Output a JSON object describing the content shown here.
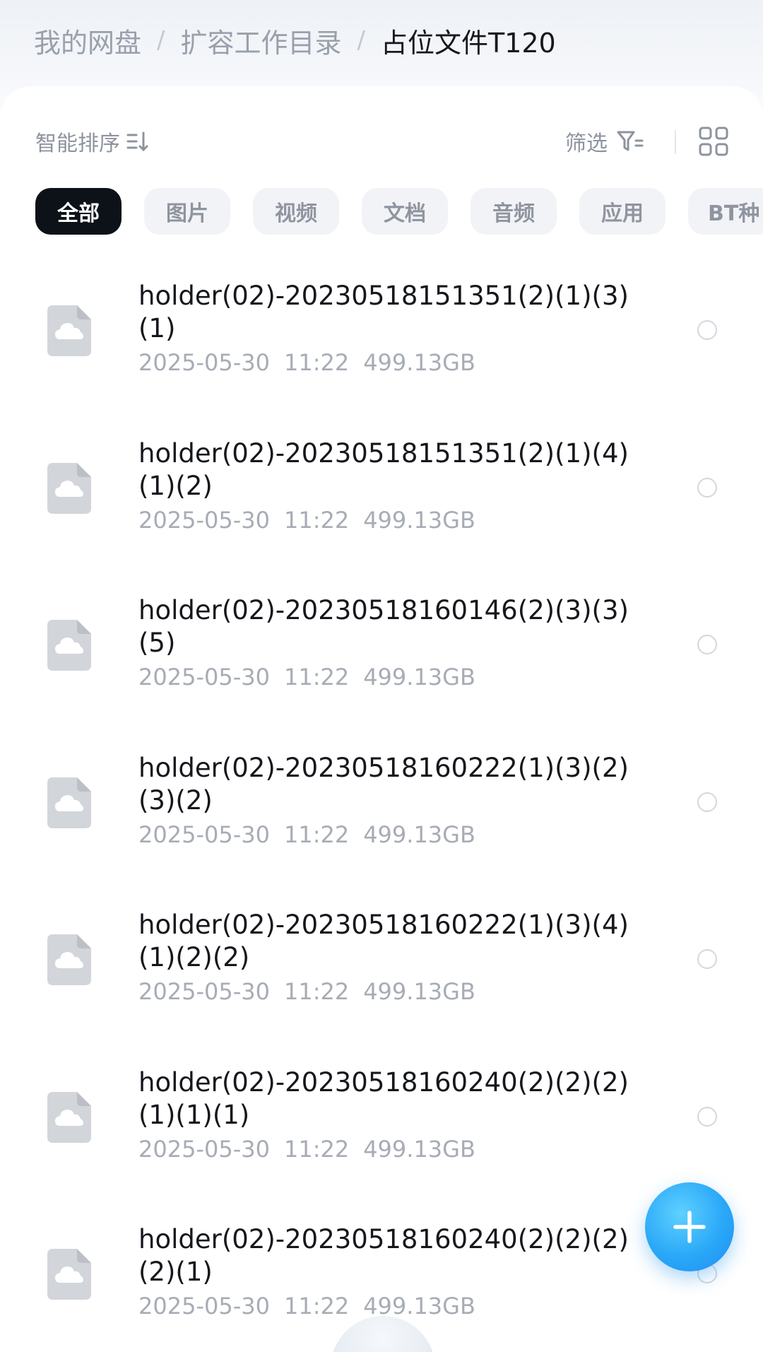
{
  "breadcrumb": {
    "items": [
      "我的网盘",
      "扩容工作目录",
      "占位文件T120"
    ],
    "separator": "/"
  },
  "toolbar": {
    "sort_label": "智能排序",
    "filter_label": "筛选"
  },
  "tabs": [
    "全部",
    "图片",
    "视频",
    "文档",
    "音频",
    "应用",
    "BT种"
  ],
  "active_tab": "全部",
  "files": [
    {
      "name": "holder(02)-20230518151351(2)(1)(3)(1)",
      "date": "2025-05-30",
      "time": "11:22",
      "size": "499.13GB"
    },
    {
      "name": "holder(02)-20230518151351(2)(1)(4)(1)(2)",
      "date": "2025-05-30",
      "time": "11:22",
      "size": "499.13GB"
    },
    {
      "name": "holder(02)-20230518160146(2)(3)(3)(5)",
      "date": "2025-05-30",
      "time": "11:22",
      "size": "499.13GB"
    },
    {
      "name": "holder(02)-20230518160222(1)(3)(2)(3)(2)",
      "date": "2025-05-30",
      "time": "11:22",
      "size": "499.13GB"
    },
    {
      "name": "holder(02)-20230518160222(1)(3)(4)(1)(2)(2)",
      "date": "2025-05-30",
      "time": "11:22",
      "size": "499.13GB"
    },
    {
      "name": "holder(02)-20230518160240(2)(2)(2)(1)(1)(1)",
      "date": "2025-05-30",
      "time": "11:22",
      "size": "499.13GB"
    },
    {
      "name": "holder(02)-20230518160240(2)(2)(2)(2)(1)",
      "date": "2025-05-30",
      "time": "11:22",
      "size": "499.13GB"
    }
  ],
  "icons": {
    "file": "cloud-file-icon",
    "sort": "sort-icon",
    "filter": "filter-icon",
    "grid": "grid-view-icon",
    "fab": "plus-icon"
  },
  "colors": {
    "fab": "#2aa8f8",
    "active_tab_bg": "#0d1118",
    "text_primary": "#15171c",
    "text_secondary": "#a7acb5"
  }
}
